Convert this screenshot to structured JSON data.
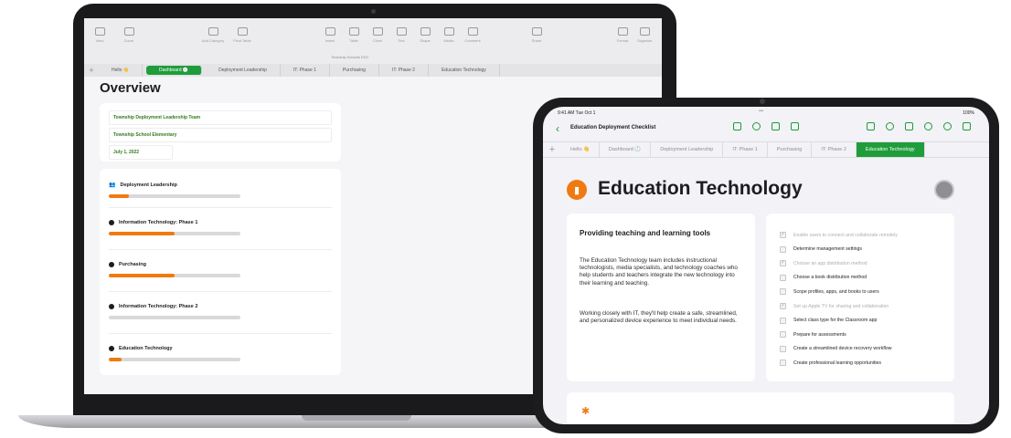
{
  "mac": {
    "toolbar_left": [
      "View",
      "Zoom"
    ],
    "toolbar_mid": [
      "Add Category",
      "Pivot Table"
    ],
    "toolbar_right": [
      "Insert",
      "Table",
      "Chart",
      "Text",
      "Shape",
      "Media",
      "Comment"
    ],
    "toolbar_share": "Share",
    "toolbar_end": [
      "Format",
      "Organize"
    ],
    "doc_title": "Township Schools EDC",
    "tabs": [
      "Hello 👋",
      "Dashboard 🕘",
      "Deployment Leadership",
      "IT: Phase 1",
      "Purchasing",
      "IT: Phase 2",
      "Education Technology"
    ],
    "page_title": "Overview",
    "fields": [
      "Township Deployment Leadership Team",
      "Township School Elementary",
      "July 1, 2022"
    ],
    "progress": [
      {
        "label": "Deployment Leadership",
        "value": 0.15
      },
      {
        "label": "Information Technology: Phase 1",
        "value": 0.5
      },
      {
        "label": "Purchasing",
        "value": 0.5
      },
      {
        "label": "Information Technology: Phase 2",
        "value": 0.0
      },
      {
        "label": "Education Technology",
        "value": 0.1
      }
    ]
  },
  "ipad": {
    "status_left": "9:41 AM  Tue Oct 1",
    "status_center": "•••",
    "status_right": "100%",
    "doc_title": "Education Deployment Checklist",
    "tabs": [
      "Hello 👋",
      "Dashboard 🕘",
      "Deployment Leadership",
      "IT: Phase 1",
      "Purchasing",
      "IT: Phase 2",
      "Education Technology"
    ],
    "section_title": "Education Technology",
    "card_heading": "Providing teaching and learning tools",
    "paragraph1": "The Education Technology team includes instructional technologists, media specialists, and technology coaches who help students and teachers integrate the new technology into their learning and teaching.",
    "paragraph2": "Working closely with IT, they'll help create a safe, streamlined, and personalized device experience to meet individual needs.",
    "checklist": [
      {
        "label": "Enable users to connect and collaborate remotely",
        "done": true
      },
      {
        "label": "Determine management settings",
        "done": false
      },
      {
        "label": "Choose an app distribution method",
        "done": true
      },
      {
        "label": "Choose a book distribution method",
        "done": false
      },
      {
        "label": "Scope profiles, apps, and books to users",
        "done": false
      },
      {
        "label": "Set up Apple TV for sharing and collaboration",
        "done": true
      },
      {
        "label": "Select class type for the Classroom app",
        "done": false
      },
      {
        "label": "Prepare for assessments",
        "done": false
      },
      {
        "label": "Create a streamlined device recovery workflow",
        "done": false
      },
      {
        "label": "Create professional learning opportunities",
        "done": false
      }
    ]
  },
  "colors": {
    "accent": "#1f9d3a",
    "progress": "#f07a10",
    "track": "#d9d9dc"
  }
}
